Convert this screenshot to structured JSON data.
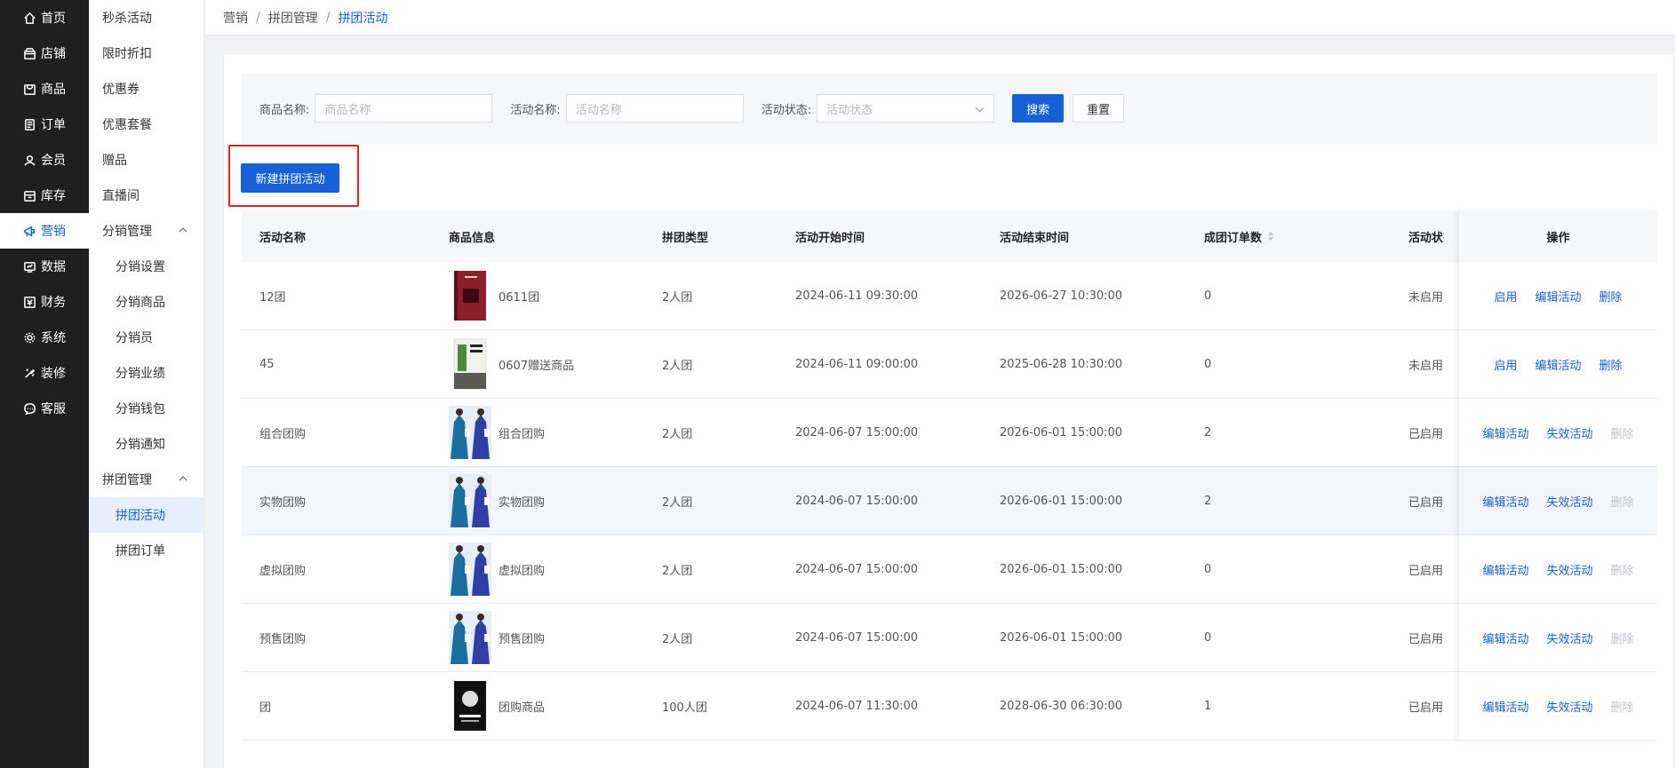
{
  "nav_main": [
    {
      "label": "首页",
      "icon": "home-icon"
    },
    {
      "label": "店铺",
      "icon": "store-icon"
    },
    {
      "label": "商品",
      "icon": "goods-icon"
    },
    {
      "label": "订单",
      "icon": "order-icon"
    },
    {
      "label": "会员",
      "icon": "member-icon"
    },
    {
      "label": "库存",
      "icon": "stock-icon"
    },
    {
      "label": "营销",
      "icon": "marketing-icon",
      "active": true
    },
    {
      "label": "数据",
      "icon": "data-icon"
    },
    {
      "label": "财务",
      "icon": "finance-icon"
    },
    {
      "label": "系统",
      "icon": "system-icon"
    },
    {
      "label": "装修",
      "icon": "decorate-icon"
    },
    {
      "label": "客服",
      "icon": "service-icon"
    }
  ],
  "nav_sub": [
    {
      "label": "秒杀活动"
    },
    {
      "label": "限时折扣"
    },
    {
      "label": "优惠券"
    },
    {
      "label": "优惠套餐"
    },
    {
      "label": "赠品"
    },
    {
      "label": "直播间"
    },
    {
      "label": "分销管理",
      "group": true
    },
    {
      "label": "分销设置",
      "child": true
    },
    {
      "label": "分销商品",
      "child": true
    },
    {
      "label": "分销员",
      "child": true
    },
    {
      "label": "分销业绩",
      "child": true
    },
    {
      "label": "分销钱包",
      "child": true
    },
    {
      "label": "分销通知",
      "child": true
    },
    {
      "label": "拼团管理",
      "group": true
    },
    {
      "label": "拼团活动",
      "child": true,
      "active": true
    },
    {
      "label": "拼团订单",
      "child": true
    }
  ],
  "breadcrumb": [
    "营销",
    "拼团管理",
    "拼团活动"
  ],
  "filter": {
    "goods_label": "商品名称:",
    "goods_placeholder": "商品名称",
    "activity_label": "活动名称:",
    "activity_placeholder": "活动名称",
    "status_label": "活动状态:",
    "status_placeholder": "活动状态",
    "search_btn": "搜索",
    "reset_btn": "重置"
  },
  "new_btn": "新建拼团活动",
  "table": {
    "headers": [
      "活动名称",
      "商品信息",
      "拼团类型",
      "活动开始时间",
      "活动结束时间",
      "成团订单数",
      "活动状态",
      "操作"
    ],
    "rows": [
      {
        "name": "12团",
        "goods": "0611团",
        "thumb": "book-red",
        "type": "2人团",
        "start": "2024-06-11 09:30:00",
        "end": "2026-06-27 10:30:00",
        "orders": "0",
        "status": "未启用",
        "ops": [
          "启用",
          "编辑活动",
          "删除"
        ],
        "disabled_last": false
      },
      {
        "name": "45",
        "goods": "0607赠送商品",
        "thumb": "book-white",
        "type": "2人团",
        "start": "2024-06-11 09:00:00",
        "end": "2025-06-28 10:30:00",
        "orders": "0",
        "status": "未启用",
        "ops": [
          "启用",
          "编辑活动",
          "删除"
        ],
        "disabled_last": false
      },
      {
        "name": "组合团购",
        "goods": "组合团购",
        "thumb": "dress",
        "type": "2人团",
        "start": "2024-06-07 15:00:00",
        "end": "2026-06-01 15:00:00",
        "orders": "2",
        "status": "已启用",
        "ops": [
          "编辑活动",
          "失效活动",
          "删除"
        ],
        "disabled_last": true
      },
      {
        "name": "实物团购",
        "goods": "实物团购",
        "thumb": "dress",
        "type": "2人团",
        "start": "2024-06-07 15:00:00",
        "end": "2026-06-01 15:00:00",
        "orders": "2",
        "status": "已启用",
        "ops": [
          "编辑活动",
          "失效活动",
          "删除"
        ],
        "disabled_last": true,
        "highlight": true
      },
      {
        "name": "虚拟团购",
        "goods": "虚拟团购",
        "thumb": "dress",
        "type": "2人团",
        "start": "2024-06-07 15:00:00",
        "end": "2026-06-01 15:00:00",
        "orders": "0",
        "status": "已启用",
        "ops": [
          "编辑活动",
          "失效活动",
          "删除"
        ],
        "disabled_last": true
      },
      {
        "name": "预售团购",
        "goods": "预售团购",
        "thumb": "dress",
        "type": "2人团",
        "start": "2024-06-07 15:00:00",
        "end": "2026-06-01 15:00:00",
        "orders": "0",
        "status": "已启用",
        "ops": [
          "编辑活动",
          "失效活动",
          "删除"
        ],
        "disabled_last": true
      },
      {
        "name": "团",
        "goods": "团购商品",
        "thumb": "book-black",
        "type": "100人团",
        "start": "2024-06-07 11:30:00",
        "end": "2028-06-30 06:30:00",
        "orders": "1",
        "status": "已启用",
        "ops": [
          "编辑活动",
          "失效活动",
          "删除"
        ],
        "disabled_last": true
      }
    ]
  }
}
